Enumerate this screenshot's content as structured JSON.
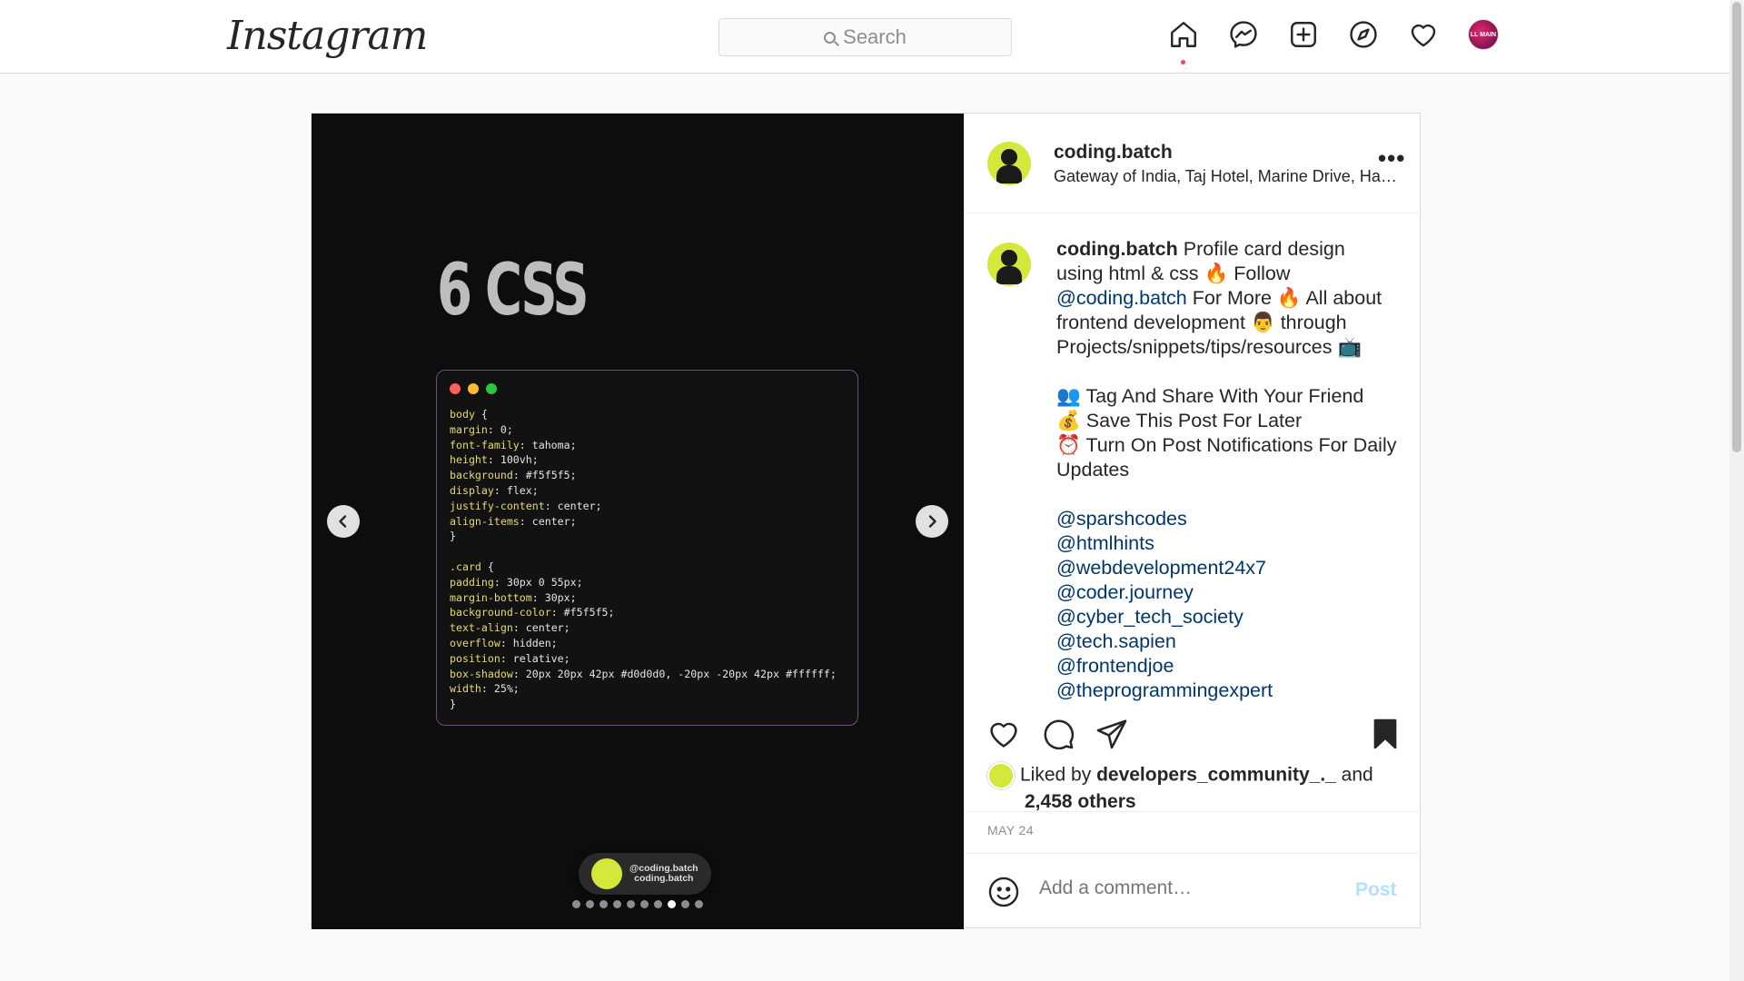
{
  "app": {
    "logo_text": "Instagram",
    "search_placeholder": "Search",
    "nav_icons": [
      "home-icon",
      "messenger-icon",
      "new-post-icon",
      "explore-icon",
      "activity-heart-icon",
      "profile-avatar"
    ],
    "profile_avatar_text": "LL MAIN"
  },
  "post": {
    "author": "coding.batch",
    "location": "Gateway of India, Taj Hotel, Marine Drive, Ha…",
    "more_label": "•••",
    "media": {
      "title": "6 CSS",
      "code_lines": [
        "body {",
        "margin: 0;",
        "font-family: tahoma;",
        "height: 100vh;",
        "background: #f5f5f5;",
        "display: flex;",
        "justify-content: center;",
        "align-items: center;",
        "}",
        "",
        ".card {",
        "padding: 30px 0 55px;",
        "margin-bottom: 30px;",
        "background-color: #f5f5f5;",
        "text-align: center;",
        "overflow: hidden;",
        "position: relative;",
        "box-shadow: 20px 20px 42px #d0d0d0, -20px -20px 42px #ffffff;",
        "width: 25%;",
        "}"
      ],
      "handle_line1": "@coding.batch",
      "handle_line2": "coding.batch",
      "slide_count": 10,
      "active_slide": 8
    },
    "caption": {
      "author": "coding.batch",
      "text1": " Profile card design using html & css 🔥 Follow ",
      "mention_follow": "@coding.batch",
      "text2": " For More 🔥 All about frontend development 👨 through Projects/snippets/tips/resources 📺",
      "line_tag": "👥 Tag And Share With Your Friend",
      "line_save": "💰 Save This Post For Later",
      "line_notify": "⏰ Turn On Post Notifications For Daily Updates",
      "mentions": [
        "@sparshcodes",
        "@htmlhints",
        "@webdevelopment24x7",
        "@coder.journey",
        "@cyber_tech_society",
        "@tech.sapien",
        "@frontendjoe",
        "@theprogrammingexpert"
      ]
    },
    "likes": {
      "prefix": "Liked by ",
      "user": "developers_community_._",
      "conj": " and",
      "others": "2,458 others"
    },
    "date": "MAY 24",
    "comment_placeholder": "Add a comment…",
    "post_label": "Post"
  },
  "colors": {
    "accent_blue": "#0095f6",
    "post_btn_disabled": "#b2dffc",
    "mention": "#00376b",
    "notification_dot": "#ed4956",
    "avatar_green": "#d4e83c"
  }
}
